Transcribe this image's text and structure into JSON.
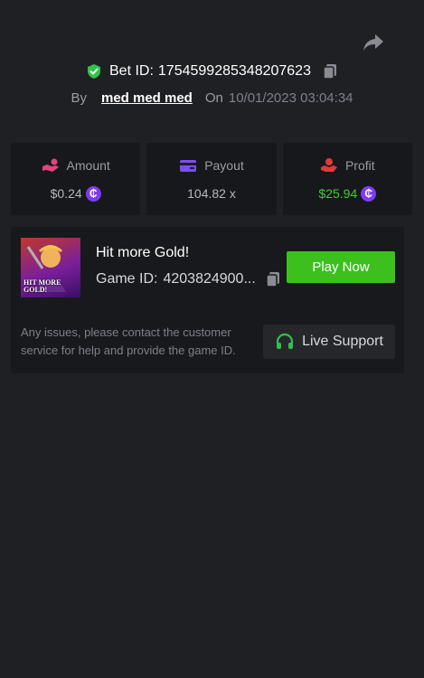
{
  "header": {
    "share_icon": "share-icon",
    "bet_id_label": "Bet ID:",
    "bet_id_value": "1754599285348207623",
    "verified_icon": "shield-check-icon",
    "copy_icon": "copy-icon",
    "by_label": "By",
    "username": "med med med",
    "on_label": "On",
    "timestamp": "10/01/2023 03:04:34"
  },
  "stats": {
    "amount": {
      "label": "Amount",
      "value": "$0.24",
      "icon": "hand-coins-icon"
    },
    "payout": {
      "label": "Payout",
      "value": "104.82 x",
      "icon": "card-icon"
    },
    "profit": {
      "label": "Profit",
      "value": "$25.94",
      "icon": "hand-money-icon"
    },
    "coin_glyph": "₵"
  },
  "game": {
    "thumb_text": "HIT MORE GOLD!",
    "name": "Hit more Gold!",
    "id_label": "Game ID:",
    "id_value": "4203824900...",
    "play_label": "Play Now",
    "help_text": "Any issues, please contact the customer service for help and provide the game ID.",
    "support_label": "Live Support",
    "support_icon": "headset-icon"
  },
  "colors": {
    "background": "#1f2024",
    "card": "#17181b",
    "accent_green": "#3dc01e",
    "profit_green": "#3fd02c",
    "coin_purple": "#7d3cf0",
    "amount_icon": "#e0457b",
    "payout_icon": "#7c4dff",
    "profit_icon": "#e03a3a"
  }
}
